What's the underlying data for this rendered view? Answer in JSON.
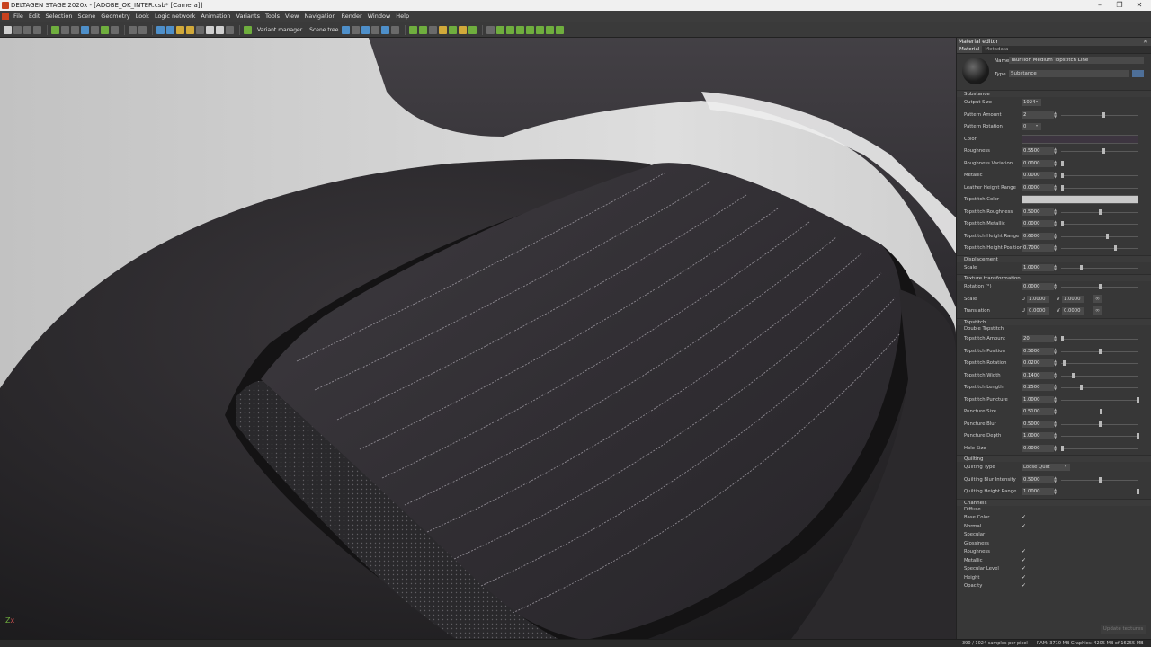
{
  "window": {
    "title": "DELTAGEN STAGE 2020x - [ADOBE_OK_INTER.csb* [Camera]]",
    "controls": [
      "–",
      "❐",
      "✕"
    ]
  },
  "menu": [
    "File",
    "Edit",
    "Selection",
    "Scene",
    "Geometry",
    "Look",
    "Logic network",
    "Animation",
    "Variants",
    "Tools",
    "View",
    "Navigation",
    "Render",
    "Window",
    "Help"
  ],
  "toolbar": {
    "variant_manager": "Variant manager",
    "scene_tree": "Scene tree"
  },
  "viewport": {
    "axis_label": "x",
    "axis_z": "Z"
  },
  "panel": {
    "title": "Material editor",
    "tabs": [
      "Material",
      "Metadata"
    ],
    "name_label": "Name",
    "name_value": "Taurillon Medium Topstitch Line",
    "type_label": "Type",
    "type_value": "Substance",
    "sections": {
      "substance": "Substance",
      "displacement": "Displacement",
      "texture_transformation": "Texture transformation",
      "topstitch": "Topstitch",
      "quilting": "Quilting",
      "channels": "Channels"
    },
    "substance_rows": [
      {
        "label": "Output Size",
        "value": "1024",
        "kind": "dropdown"
      },
      {
        "label": "Pattern Amount",
        "value": "2",
        "kind": "slider",
        "level": 0.55
      },
      {
        "label": "Pattern Rotation",
        "value": "0",
        "kind": "dropdown"
      },
      {
        "label": "Color",
        "value": "",
        "kind": "color",
        "color": "#3d3540"
      },
      {
        "label": "Roughness",
        "value": "0.5500",
        "kind": "slider",
        "level": 0.55
      },
      {
        "label": "Roughness Variation",
        "value": "0.0000",
        "kind": "slider",
        "level": 0.0
      },
      {
        "label": "Metallic",
        "value": "0.0000",
        "kind": "slider",
        "level": 0.0
      },
      {
        "label": "Leather Height Range",
        "value": "0.0000",
        "kind": "slider",
        "level": 0.0
      },
      {
        "label": "Topstitch Color",
        "value": "",
        "kind": "color",
        "color": "#c9c9c9"
      },
      {
        "label": "Topstitch Roughness",
        "value": "0.5000",
        "kind": "slider",
        "level": 0.5
      },
      {
        "label": "Topstitch Metallic",
        "value": "0.0000",
        "kind": "slider",
        "level": 0.0
      },
      {
        "label": "Topstitch Height Range",
        "value": "0.6000",
        "kind": "slider",
        "level": 0.6
      },
      {
        "label": "Topstitch Height Position",
        "value": "0.7000",
        "kind": "slider",
        "level": 0.7
      }
    ],
    "displacement_rows": [
      {
        "label": "Scale",
        "value": "1.0000",
        "kind": "slider",
        "level": 0.25
      }
    ],
    "texture_rows": {
      "rotation_label": "Rotation (°)",
      "rotation_value": "0.0000",
      "rotation_level": 0.5,
      "scale_label": "Scale",
      "scale_u": "1.0000",
      "scale_v": "1.0000",
      "translation_label": "Translation",
      "translation_u": "0.0000",
      "translation_v": "0.0000",
      "u": "U",
      "v": "V"
    },
    "topstitch_double": "Double Topstitch",
    "topstitch_rows": [
      {
        "label": "Topstitch Amount",
        "value": "20",
        "kind": "slider",
        "level": 0.0
      },
      {
        "label": "Topstitch Position",
        "value": "0.5000",
        "kind": "slider",
        "level": 0.5
      },
      {
        "label": "Topstitch Rotation",
        "value": "0.0200",
        "kind": "slider",
        "level": 0.02
      },
      {
        "label": "Topstitch Width",
        "value": "0.1400",
        "kind": "slider",
        "level": 0.14
      },
      {
        "label": "Topstitch Length",
        "value": "0.2500",
        "kind": "slider",
        "level": 0.25
      },
      {
        "label": "Topstitch Puncture",
        "value": "1.0000",
        "kind": "slider",
        "level": 1.0
      },
      {
        "label": "Puncture Size",
        "value": "0.5100",
        "kind": "slider",
        "level": 0.51
      },
      {
        "label": "Puncture Blur",
        "value": "0.5000",
        "kind": "slider",
        "level": 0.5
      },
      {
        "label": "Puncture Depth",
        "value": "1.0000",
        "kind": "slider",
        "level": 1.0
      },
      {
        "label": "Hole Size",
        "value": "0.0000",
        "kind": "slider",
        "level": 0.0
      }
    ],
    "quilting_rows": [
      {
        "label": "Quilting Type",
        "value": "Loose Quilt",
        "kind": "dropdown"
      },
      {
        "label": "Quilting Blur Intensity",
        "value": "0.5000",
        "kind": "slider",
        "level": 0.5
      },
      {
        "label": "Quilting Height Range",
        "value": "1.0000",
        "kind": "slider",
        "level": 1.0
      }
    ],
    "channels": [
      {
        "label": "Diffuse",
        "checked": false
      },
      {
        "label": "Base Color",
        "checked": true
      },
      {
        "label": "Normal",
        "checked": true
      },
      {
        "label": "Specular",
        "checked": false
      },
      {
        "label": "Glossiness",
        "checked": false
      },
      {
        "label": "Roughness",
        "checked": true
      },
      {
        "label": "Metallic",
        "checked": true
      },
      {
        "label": "Specular Level",
        "checked": true
      },
      {
        "label": "Height",
        "checked": true
      },
      {
        "label": "Opacity",
        "checked": true
      }
    ],
    "update_button": "Update textures"
  },
  "status": {
    "samples": "390 / 1024 samples per pixel",
    "memory": "RAM: 3710 MB Graphics: 4205 MB of 16255 MB"
  }
}
